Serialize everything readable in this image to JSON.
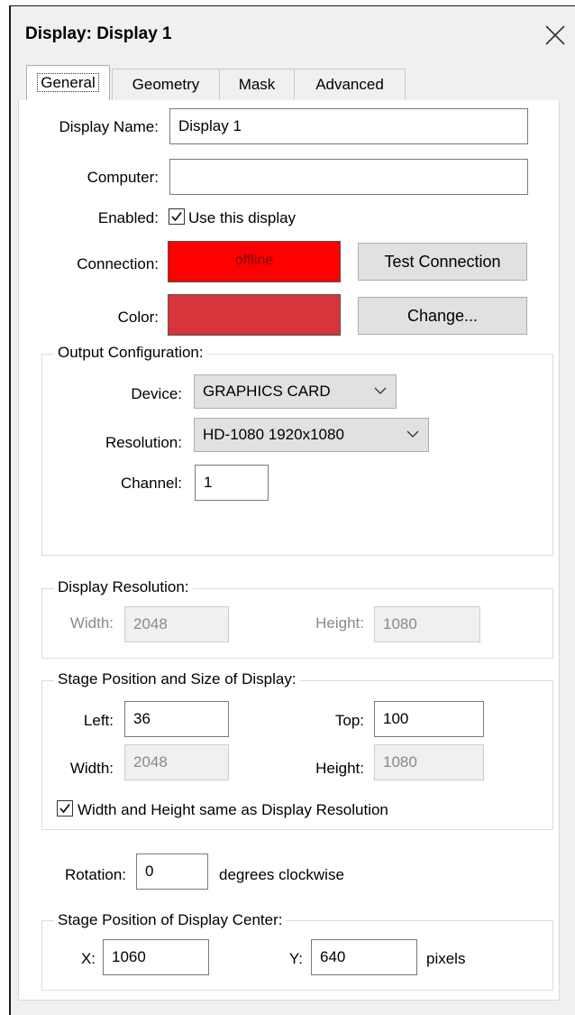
{
  "window": {
    "title": "Display: Display 1"
  },
  "tabs": [
    {
      "label": "General",
      "active": true
    },
    {
      "label": "Geometry",
      "active": false
    },
    {
      "label": "Mask",
      "active": false
    },
    {
      "label": "Advanced",
      "active": false
    }
  ],
  "general": {
    "display_name_label": "Display Name:",
    "display_name_value": "Display 1",
    "computer_label": "Computer:",
    "computer_value": "",
    "enabled_label": "Enabled:",
    "enabled_checkbox_label": "Use this display",
    "enabled_checked": true,
    "connection_label": "Connection:",
    "connection_status": "offline",
    "connection_color": "#ff0000",
    "test_connection_button": "Test Connection",
    "color_label": "Color:",
    "color_value": "#d7343c",
    "change_button": "Change..."
  },
  "output_configuration": {
    "title": "Output Configuration:",
    "device_label": "Device:",
    "device_value": "GRAPHICS CARD",
    "resolution_label": "Resolution:",
    "resolution_value": "HD-1080 1920x1080",
    "channel_label": "Channel:",
    "channel_value": "1"
  },
  "display_resolution": {
    "title": "Display Resolution:",
    "width_label": "Width:",
    "width_value": "2048",
    "height_label": "Height:",
    "height_value": "1080"
  },
  "stage_position_size": {
    "title": "Stage Position and Size of Display:",
    "left_label": "Left:",
    "left_value": "36",
    "top_label": "Top:",
    "top_value": "100",
    "width_label": "Width:",
    "width_value": "2048",
    "height_label": "Height:",
    "height_value": "1080",
    "same_as_resolution_label": "Width and Height same as Display Resolution",
    "same_as_resolution_checked": true
  },
  "rotation": {
    "label": "Rotation:",
    "value": "0",
    "unit_label": "degrees clockwise"
  },
  "stage_center": {
    "title": "Stage Position of Display Center:",
    "x_label": "X:",
    "x_value": "1060",
    "y_label": "Y:",
    "y_value": "640",
    "unit_label": "pixels"
  }
}
